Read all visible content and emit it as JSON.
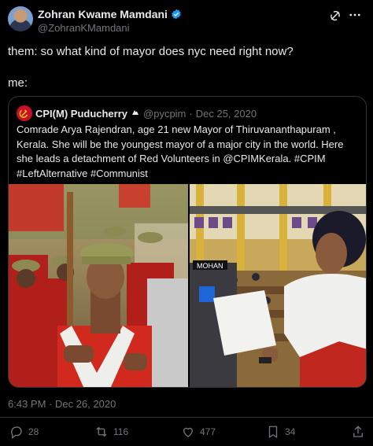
{
  "author": {
    "name": "Zohran Kwame Mamdani",
    "handle": "@ZohranKMamdani"
  },
  "tweet": {
    "lines": [
      "them: so what kind of mayor does nyc need right now?",
      "me:"
    ],
    "timestamp": "6:43 PM · Dec 26, 2020"
  },
  "quote": {
    "name": "CPI(M) Puducherry",
    "handle": "@pycpim",
    "separator": "·",
    "date": "Dec 25, 2020",
    "text": "Comrade Arya Rajendran, age 21  new Mayor of Thiruvananthapuram , Kerala. She will be the youngest mayor of a major city in the world. Here she leads a detachment of Red Volunteers in @CPIMKerala. #CPIM  #LeftAlternative #Communist",
    "podium_sign": "MOHAN"
  },
  "actions": {
    "replies": "28",
    "reposts": "116",
    "likes": "477",
    "bookmarks": "34"
  },
  "colors": {
    "background": "#000000",
    "text": "#e7e9ea",
    "muted": "#71767b",
    "border": "#2f3336",
    "verified": "#1d9bf0",
    "cpim_red": "#c8102e"
  },
  "icons": [
    "verified-badge-icon",
    "grok-icon",
    "more-icon",
    "hammer-sickle-icon",
    "bot-icon",
    "reply-icon",
    "repost-icon",
    "like-icon",
    "bookmark-icon",
    "share-icon"
  ]
}
